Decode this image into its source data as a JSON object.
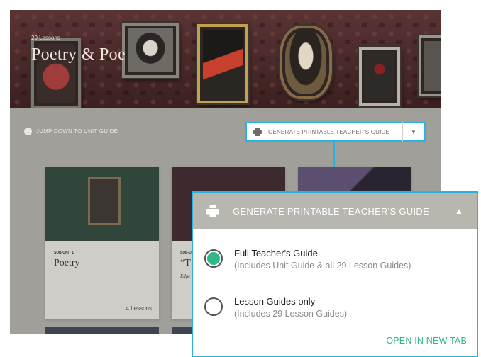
{
  "banner": {
    "lesson_count": "29 Lessons",
    "title": "Poetry & Poe"
  },
  "toolbar": {
    "jump_label": "JUMP DOWN TO UNIT GUIDE",
    "print_button_label": "GENERATE PRINTABLE TEACHER'S GUIDE",
    "print_icon": "printer-icon",
    "caret": "▼"
  },
  "cards": [
    {
      "tag": "SUB-UNIT 1",
      "title": "Poetry",
      "subtitle": "",
      "count": "4 Lessons"
    },
    {
      "tag": "SUB-U",
      "title": "“T",
      "subtitle": "Edge",
      "count": ""
    },
    {
      "tag": "",
      "title": "",
      "subtitle": "",
      "count": ""
    }
  ],
  "dropdown": {
    "header": "GENERATE PRINTABLE TEACHER'S GUIDE",
    "caret": "▲",
    "options": [
      {
        "title": "Full Teacher's Guide",
        "sub": "(Includes Unit Guide & all 29 Lesson Guides)",
        "selected": true
      },
      {
        "title": "Lesson Guides only",
        "sub": "(Includes 29 Lesson Guides)",
        "selected": false
      }
    ],
    "open_link": "OPEN IN NEW TAB"
  },
  "colors": {
    "accent_border": "#28b4de",
    "selected_green": "#2fb889",
    "header_gray": "#b7b7af"
  }
}
